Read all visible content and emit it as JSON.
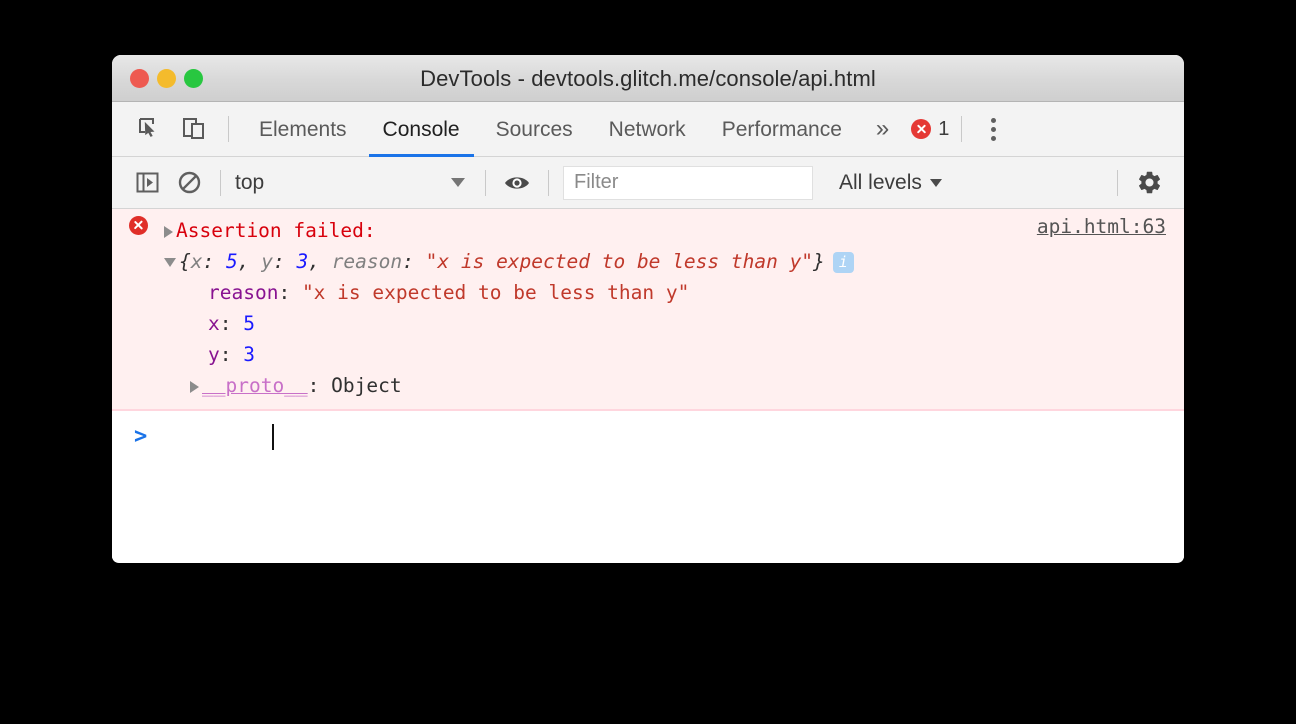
{
  "window": {
    "title": "DevTools - devtools.glitch.me/console/api.html",
    "traffic_lights": [
      {
        "name": "close",
        "color": "#ee5a51"
      },
      {
        "name": "minimize",
        "color": "#f4bb2c"
      },
      {
        "name": "zoom",
        "color": "#28c740"
      }
    ]
  },
  "tabbar": {
    "inspect_icon": "inspect-element-icon",
    "device_icon": "device-toolbar-icon",
    "tabs": [
      {
        "label": "Elements",
        "active": false
      },
      {
        "label": "Console",
        "active": true
      },
      {
        "label": "Sources",
        "active": false
      },
      {
        "label": "Network",
        "active": false
      },
      {
        "label": "Performance",
        "active": false
      }
    ],
    "overflow_label": "»",
    "error_count": "1",
    "menu_icon": "more-vertical-icon"
  },
  "console_toolbar": {
    "sidebar_icon": "console-sidebar-icon",
    "clear_icon": "clear-console-icon",
    "context": "top",
    "eye_icon": "live-expression-eye-icon",
    "filter_placeholder": "Filter",
    "filter_value": "",
    "levels": "All levels",
    "settings_icon": "settings-gear-icon"
  },
  "console": {
    "error_message": {
      "icon": "error-circle-icon",
      "title": "Assertion failed:",
      "source_link": "api.html:63",
      "info_badge": "i",
      "preview": {
        "open_brace": "{",
        "close_brace": "}",
        "entries": [
          {
            "key": "x",
            "sep": ": ",
            "value": "5",
            "type": "number"
          },
          {
            "key": "y",
            "sep": ": ",
            "value": "3",
            "type": "number"
          },
          {
            "key": "reason",
            "sep": ": ",
            "value": "\"x is expected to be less than y\"",
            "type": "string"
          }
        ],
        "comma": ", "
      },
      "properties": [
        {
          "key": "reason",
          "sep": ": ",
          "value": "\"x is expected to be less than y\"",
          "type": "string"
        },
        {
          "key": "x",
          "sep": ": ",
          "value": "5",
          "type": "number"
        },
        {
          "key": "y",
          "sep": ": ",
          "value": "3",
          "type": "number"
        }
      ],
      "proto": {
        "key": "__proto__",
        "sep": ": ",
        "value": "Object"
      }
    },
    "prompt_symbol": ">",
    "prompt_value": ""
  },
  "colors": {
    "accent_blue": "#1a73e8",
    "error_red": "#e02e28",
    "error_bg": "#fff0f0",
    "string_red": "#c0392b",
    "number_blue": "#1a1aff",
    "key_purple": "#881391",
    "proto_purple": "#c870c8"
  }
}
